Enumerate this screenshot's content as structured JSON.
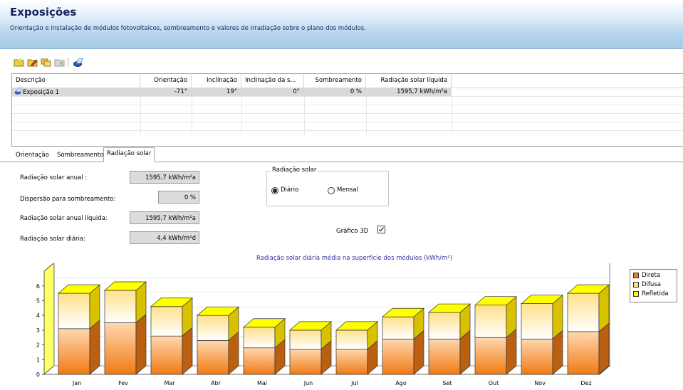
{
  "header": {
    "title": "Exposições",
    "subtitle": "Orientação e instalação de módulos fotovoltaicos, sombreamento e valores de irradiação sobre o plano dos módulos."
  },
  "toolbar": {
    "icons": [
      "new-exposure-icon",
      "edit-exposure-icon",
      "copy-exposure-icon",
      "delete-exposure-icon",
      "check-icon"
    ]
  },
  "table": {
    "columns": [
      "Descrição",
      "Orientação",
      "Inclinação",
      "Inclinação da s...",
      "Sombreamento",
      "Radiação solar líquida"
    ],
    "rows": [
      [
        "Exposição 1",
        "-71°",
        "19°",
        "0°",
        "0 %",
        "1595,7 kWh/m²a"
      ]
    ]
  },
  "tabs": [
    "Orientação",
    "Sombreamento",
    "Radiação solar"
  ],
  "active_tab": "Radiação solar",
  "form": {
    "annual_label": "Radiação solar anual :",
    "annual_value": "1595,7 kWh/m²a",
    "dispersion_label": "Dispersão para sombreamento:",
    "dispersion_value": "0 %",
    "net_label": "Radiação solar anual líquida:",
    "net_value": "1595,7 kWh/m²a",
    "daily_label": "Radiação solar diária:",
    "daily_value": "4,4 kWh/m²d",
    "group_title": "Radiação solar",
    "option_daily": "Diário",
    "option_monthly": "Mensal",
    "selected_option": "Diário",
    "chart3d_label": "Gráfico 3D",
    "chart3d_checked": true
  },
  "colors": {
    "direct": "#f07a14",
    "diffuse": "#ffe08a",
    "reflected": "#ffff00",
    "chart_title": "#3030a0"
  },
  "chart_data": {
    "type": "bar",
    "stacked": true,
    "three_d": true,
    "title": "Radiação solar diária média na superfície dos módulos (kWh/m²)",
    "categories": [
      "Jan",
      "Fev",
      "Mar",
      "Abr",
      "Mai",
      "Jun",
      "Jul",
      "Ago",
      "Set",
      "Out",
      "Nov",
      "Dez"
    ],
    "series": [
      {
        "name": "Direta",
        "values": [
          3.1,
          3.5,
          2.6,
          2.3,
          1.8,
          1.7,
          1.7,
          2.4,
          2.4,
          2.5,
          2.4,
          2.9
        ]
      },
      {
        "name": "Difusa",
        "values": [
          2.4,
          2.2,
          2.0,
          1.7,
          1.4,
          1.3,
          1.3,
          1.5,
          1.8,
          2.2,
          2.4,
          2.6
        ]
      },
      {
        "name": "Refletida",
        "values": [
          0.0,
          0.0,
          0.0,
          0.0,
          0.0,
          0.0,
          0.0,
          0.0,
          0.0,
          0.0,
          0.0,
          0.0
        ]
      }
    ],
    "yticks": [
      0,
      1,
      2,
      3,
      4,
      5,
      6
    ],
    "ylim": [
      0,
      7
    ],
    "legend_position": "right"
  }
}
